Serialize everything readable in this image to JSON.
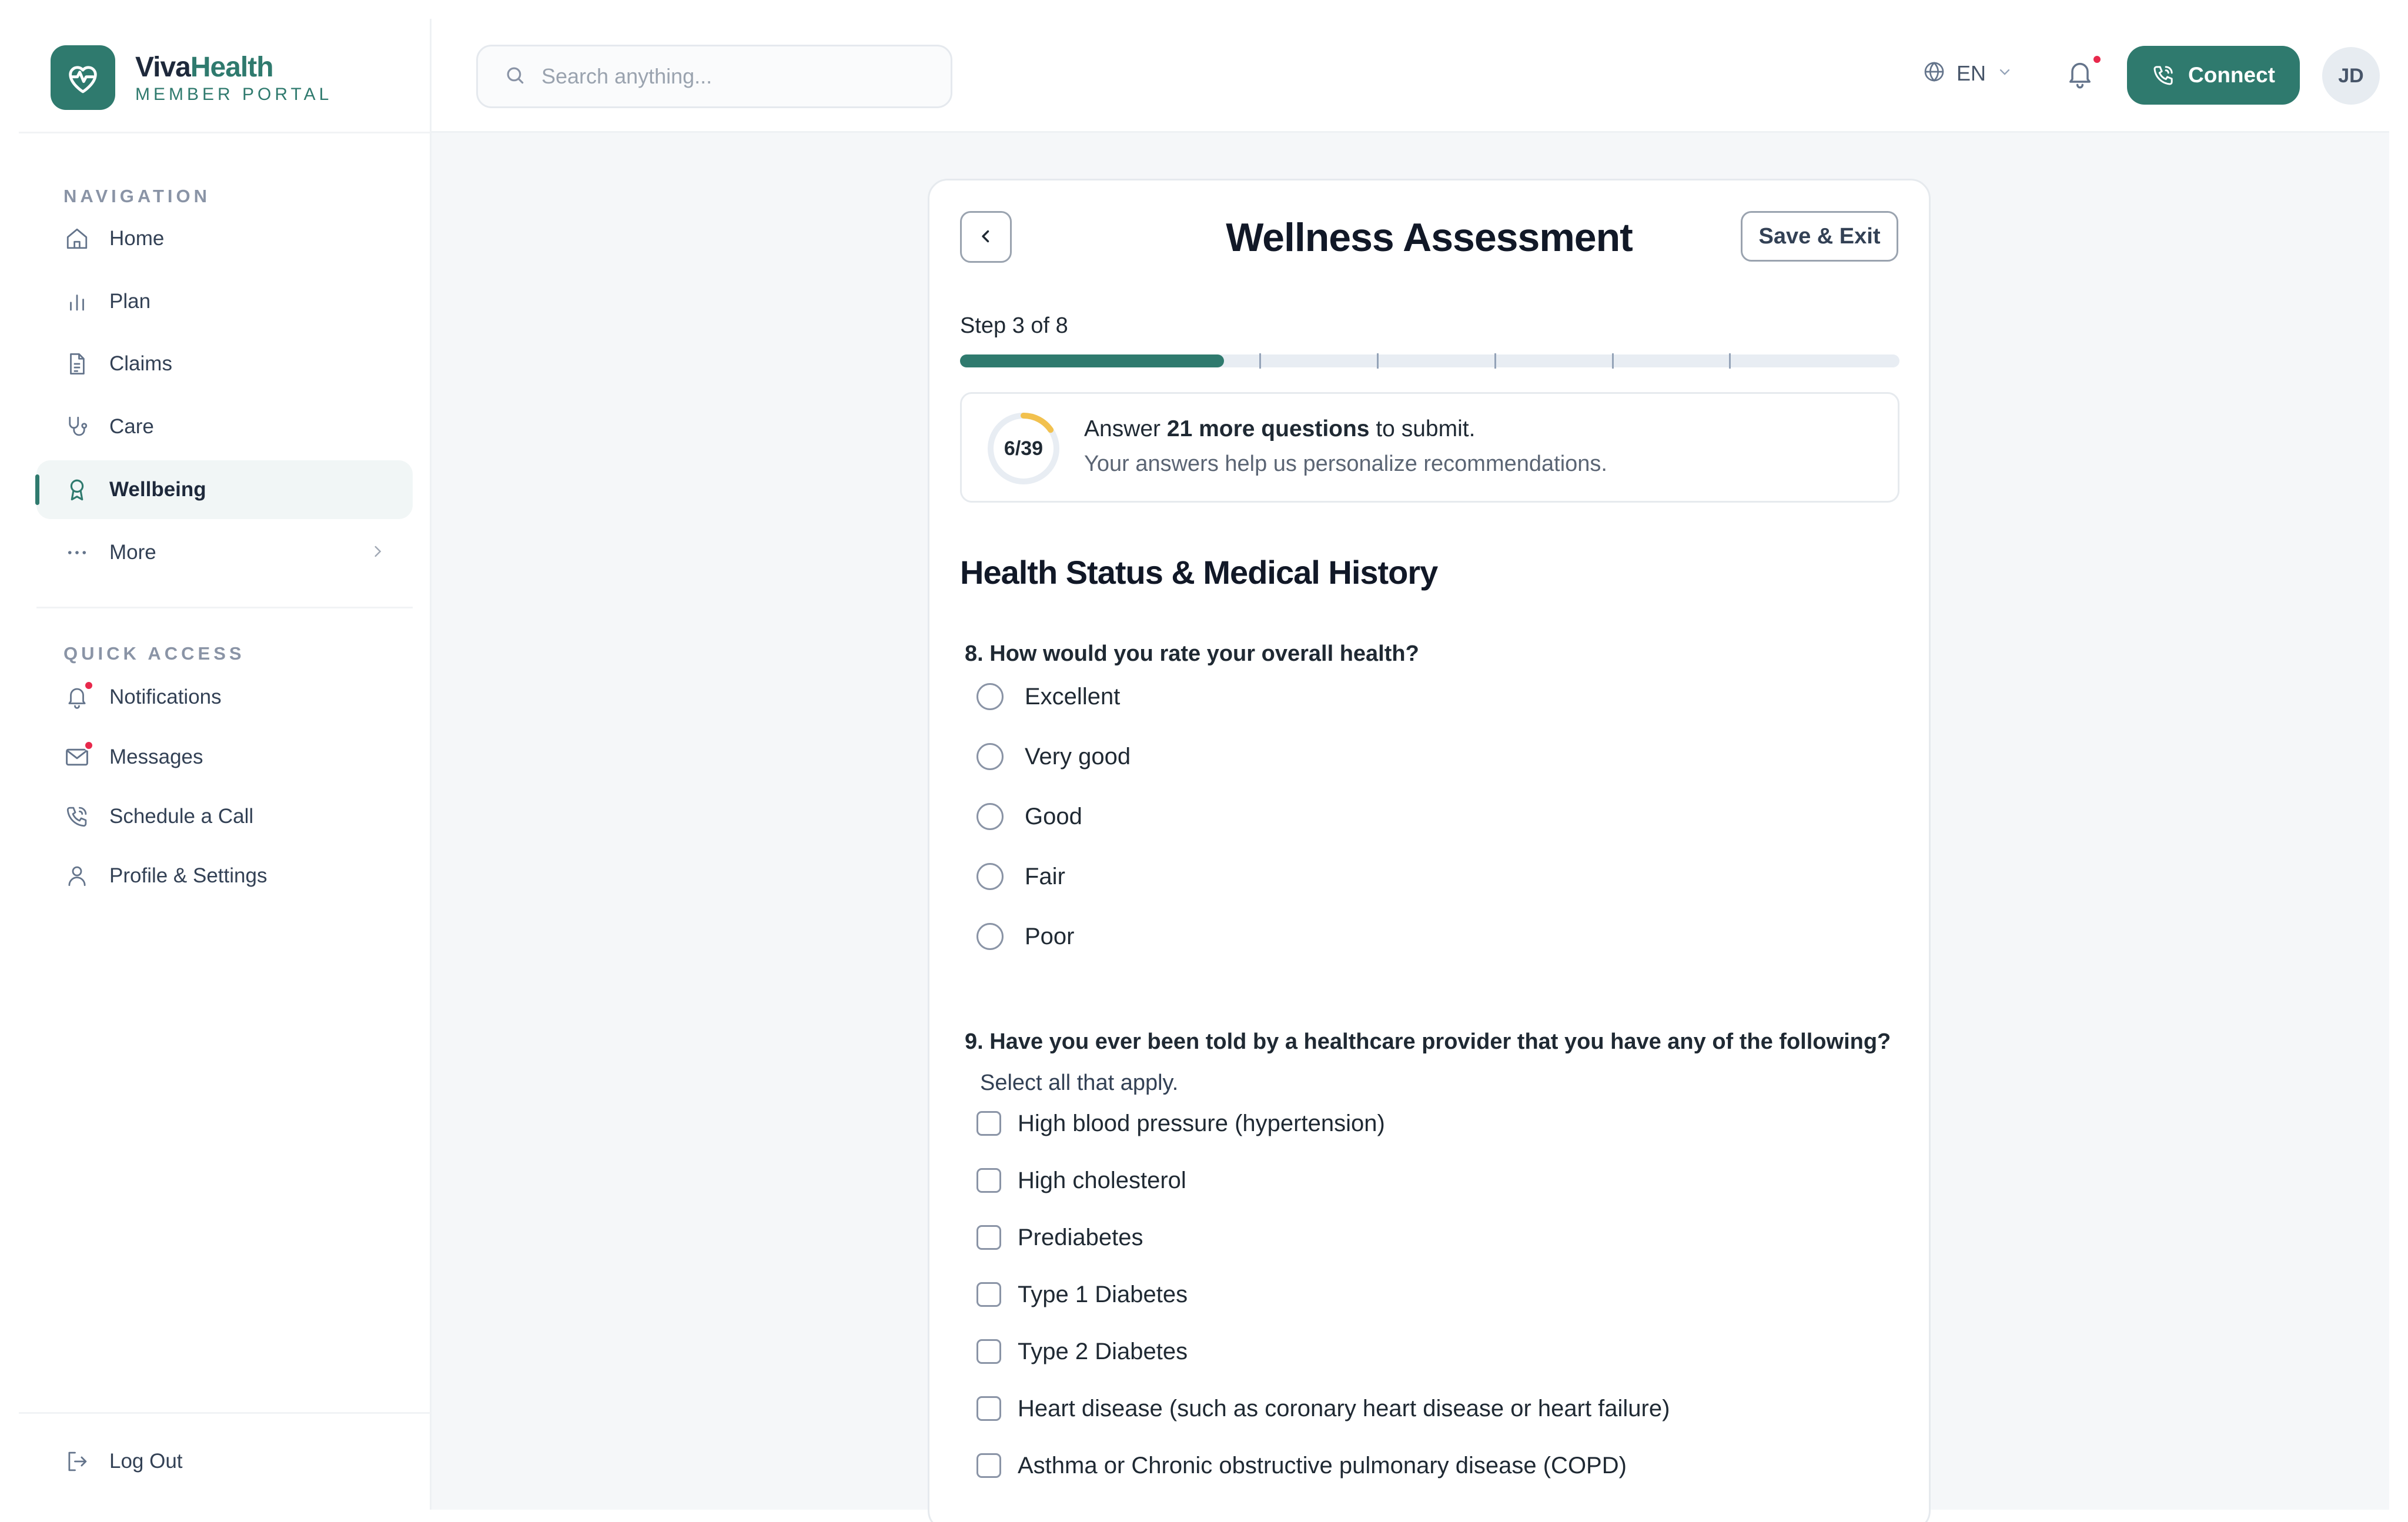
{
  "brand": {
    "name_part1": "Viva",
    "name_part2": "Health",
    "subtitle": "MEMBER PORTAL"
  },
  "sidebar": {
    "nav_label": "NAVIGATION",
    "nav": [
      {
        "label": "Home",
        "icon": "home-icon"
      },
      {
        "label": "Plan",
        "icon": "bar-chart-icon"
      },
      {
        "label": "Claims",
        "icon": "document-icon"
      },
      {
        "label": "Care",
        "icon": "stethoscope-icon"
      },
      {
        "label": "Wellbeing",
        "icon": "award-icon",
        "active": true
      },
      {
        "label": "More",
        "icon": "more-icon"
      }
    ],
    "quick_label": "QUICK ACCESS",
    "quick": [
      {
        "label": "Notifications",
        "icon": "bell-icon"
      },
      {
        "label": "Messages",
        "icon": "mail-icon"
      },
      {
        "label": "Schedule a Call",
        "icon": "phone-icon"
      },
      {
        "label": "Profile & Settings",
        "icon": "user-icon"
      }
    ],
    "logout": "Log Out"
  },
  "header": {
    "search_placeholder": "Search anything...",
    "language": "EN",
    "connect_label": "Connect",
    "avatar_initials": "JD"
  },
  "assessment": {
    "title": "Wellness Assessment",
    "save_exit": "Save & Exit",
    "step_label": "Step 3 of 8",
    "step_current": 3,
    "step_total": 8,
    "answered": 6,
    "total_questions": 39,
    "ring_text": "6/39",
    "summary_pre": "Answer ",
    "summary_bold": "21 more questions",
    "summary_post": " to submit.",
    "summary_sub": "Your answers help us personalize recommendations.",
    "section_title": "Health Status & Medical History",
    "q8": {
      "title": "8.  How would you rate your overall health?",
      "options": [
        "Excellent",
        "Very good",
        "Good",
        "Fair",
        "Poor"
      ]
    },
    "q9": {
      "title": "9.  Have you ever been told by a healthcare provider that you have any of the following?",
      "subtitle": "Select all that apply.",
      "options": [
        "High blood pressure (hypertension)",
        "High cholesterol",
        "Prediabetes",
        "Type 1 Diabetes",
        "Type 2 Diabetes",
        "Heart disease (such as coronary heart disease or heart failure)",
        "Asthma or Chronic obstructive pulmonary disease (COPD)"
      ]
    }
  },
  "colors": {
    "brand": "#2f7a6e",
    "badge": "#e8294c",
    "ring_progress": "#f2c14e"
  }
}
